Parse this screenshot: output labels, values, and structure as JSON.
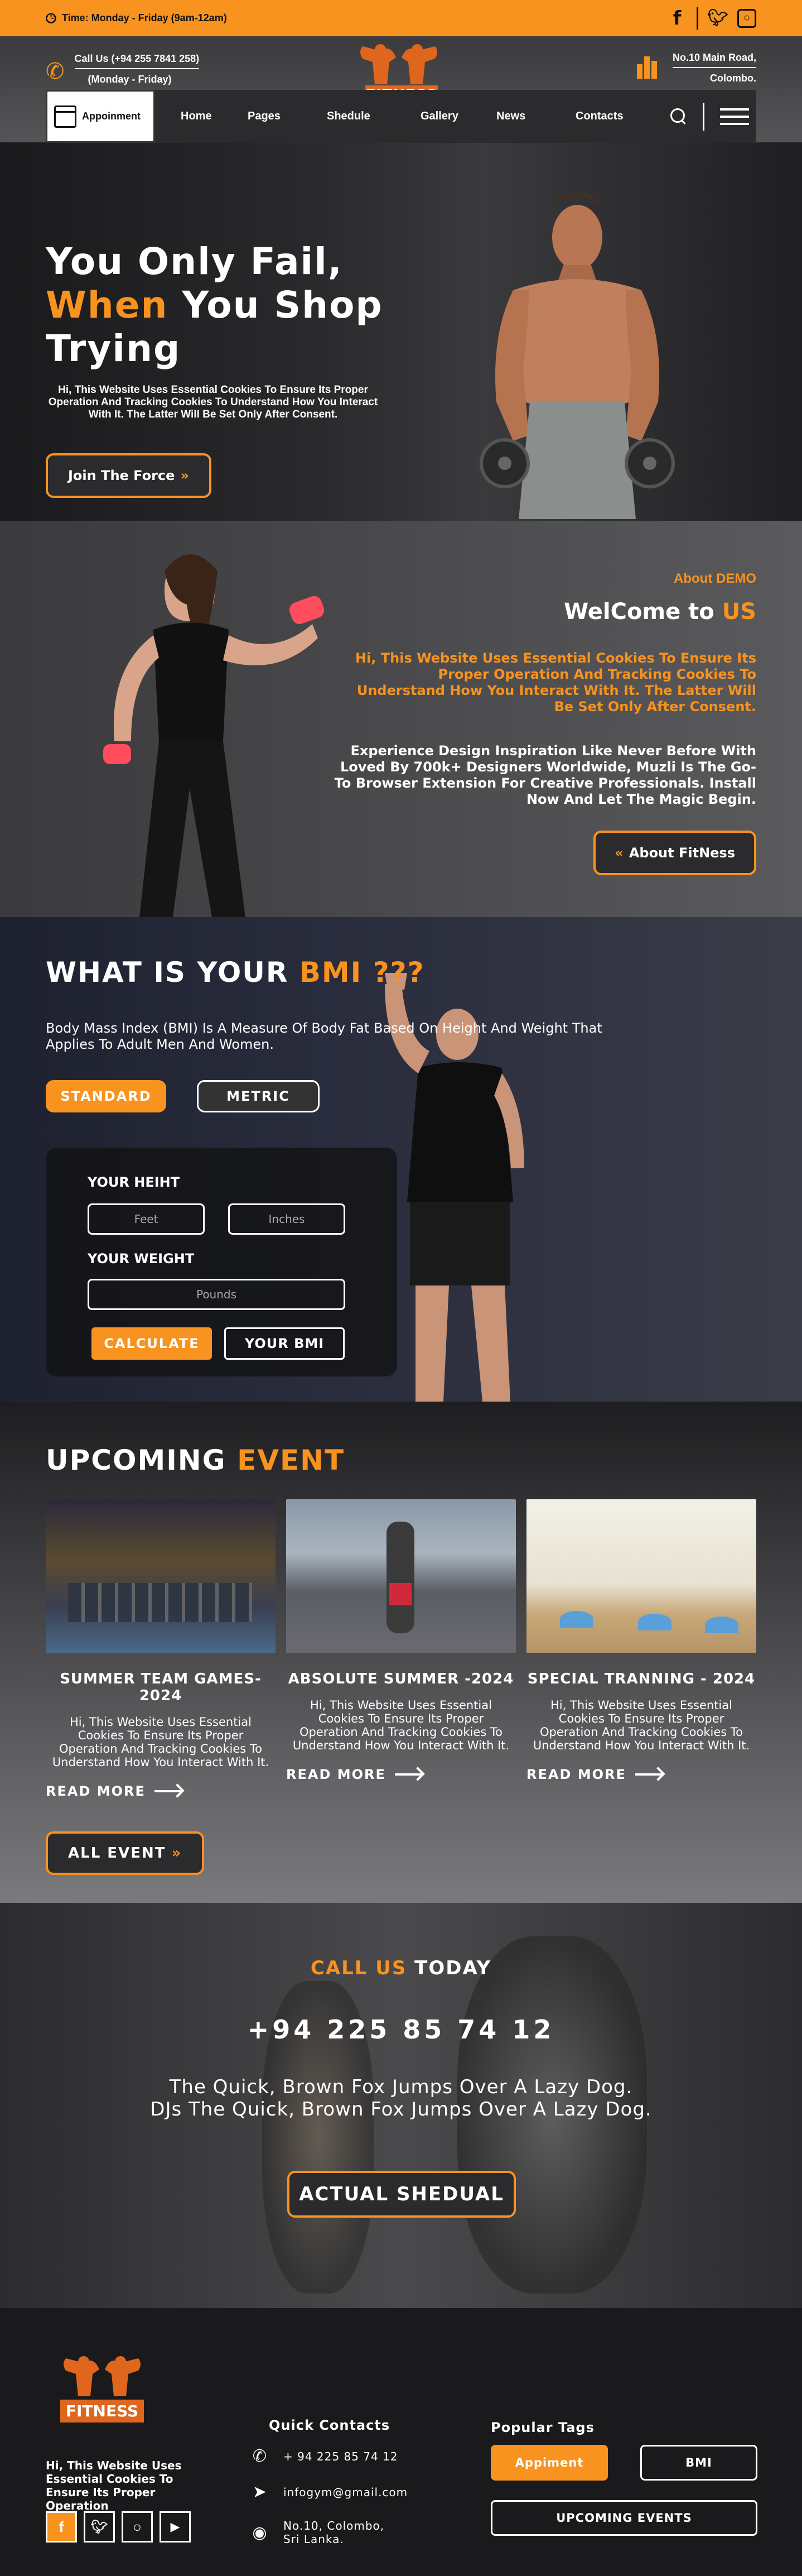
{
  "topbar": {
    "hours": "Time: Monday - Friday (9am-12am)",
    "social": [
      "facebook-icon",
      "twitter-icon",
      "instagram-icon"
    ]
  },
  "header": {
    "call_line1": "Call Us (+94  255 7841 258)",
    "call_line2": "(Monday - Friday)",
    "address_line1": "No.10 Main Road,",
    "address_line2": "Colombo.",
    "logo_text": "FITNESS"
  },
  "nav": {
    "brand": "Appoinment",
    "links": [
      "Home",
      "Pages",
      "Shedule",
      "Gallery",
      "News",
      "Contacts"
    ]
  },
  "hero": {
    "line1": "You Only Fail,",
    "line2_accent": "When",
    "line2_rest": " You Shop",
    "line3": "Trying",
    "text": "Hi, This Website Uses Essential Cookies To Ensure Its Proper Operation And Tracking Cookies To Understand How You Interact With It. The Latter Will Be Set Only After Consent.",
    "button": "Join The Force",
    "button_icon": "»"
  },
  "about": {
    "tag": "About DEMO",
    "title_white": "WelCome to ",
    "title_accent": "US",
    "text_orange": "Hi, This Website Uses Essential Cookies To Ensure Its Proper Operation And Tracking Cookies To Understand How You Interact With It. The Latter Will Be Set Only After Consent.",
    "text_white": "Experience Design Inspiration Like Never Before With Loved By 700k+ Designers Worldwide, Muzli Is The Go-To Browser Extension For Creative Professionals. Install Now And Let The Magic Begin.",
    "button": "About FitNess",
    "button_icon": "«"
  },
  "bmi": {
    "title_white": "WHAT IS YOUR ",
    "title_accent": "BMI ???",
    "desc": "Body Mass Index (BMI) Is A Measure Of Body Fat Based On Height And Weight That Applies To Adult Men And Women.",
    "tab_standard": "STANDARD",
    "tab_metric": "METRIC",
    "height_label": "YOUR HEIHT",
    "feet_placeholder": "Feet",
    "inches_placeholder": "Inches",
    "weight_label": "YOUR WEIGHT",
    "pounds_placeholder": "Pounds",
    "calculate": "CALCULATE",
    "your_bmi": "YOUR BMI"
  },
  "events": {
    "title_white": "UPCOMING ",
    "title_accent": "EVENT",
    "items": [
      {
        "title": "SUMMER TEAM GAMES-2024",
        "text": "Hi, This Website Uses Essential Cookies To Ensure Its Proper Operation And Tracking Cookies To Understand How You Interact With It.",
        "more": "READ MORE"
      },
      {
        "title": "ABSOLUTE SUMMER -2024",
        "text": "Hi, This Website Uses Essential Cookies To Ensure Its Proper Operation And Tracking Cookies To Understand How You Interact With It.",
        "more": "READ MORE"
      },
      {
        "title": "SPECIAL TRANNING - 2024",
        "text": "Hi, This Website Uses Essential Cookies To Ensure Its Proper Operation And Tracking Cookies To Understand How You Interact With It.",
        "more": "READ MORE"
      }
    ],
    "all_button": "ALL EVENT",
    "all_icon": "»"
  },
  "call": {
    "title_accent": "CALL US",
    "title_rest": " TODAY",
    "number": "+94 225 85 74 12",
    "quote_line1": "The Quick, Brown Fox Jumps Over  A Lazy Dog.",
    "quote_line2": "DJs The Quick, Brown Fox Jumps Over A Lazy Dog.",
    "button": "ACTUAL SHEDUAL"
  },
  "footer": {
    "logo_text": "FITNESS",
    "about": "Hi, This Website Uses Essential Cookies To Ensure Its Proper Operation",
    "quick_title": "Quick Contacts",
    "phone": "+ 94 225 85 74 12",
    "email": "infogym@gmail.com",
    "address": "No.10, Colombo, Sri Lanka.",
    "tags_title": "Popular Tags",
    "tags": [
      "Appiment",
      "BMI",
      "UPCOMING EVENTS"
    ],
    "social": [
      "facebook-icon",
      "twitter-icon",
      "instagram-icon",
      "youtube-icon"
    ]
  },
  "colors": {
    "accent": "#f7931e",
    "dark": "#1c1c1e"
  }
}
